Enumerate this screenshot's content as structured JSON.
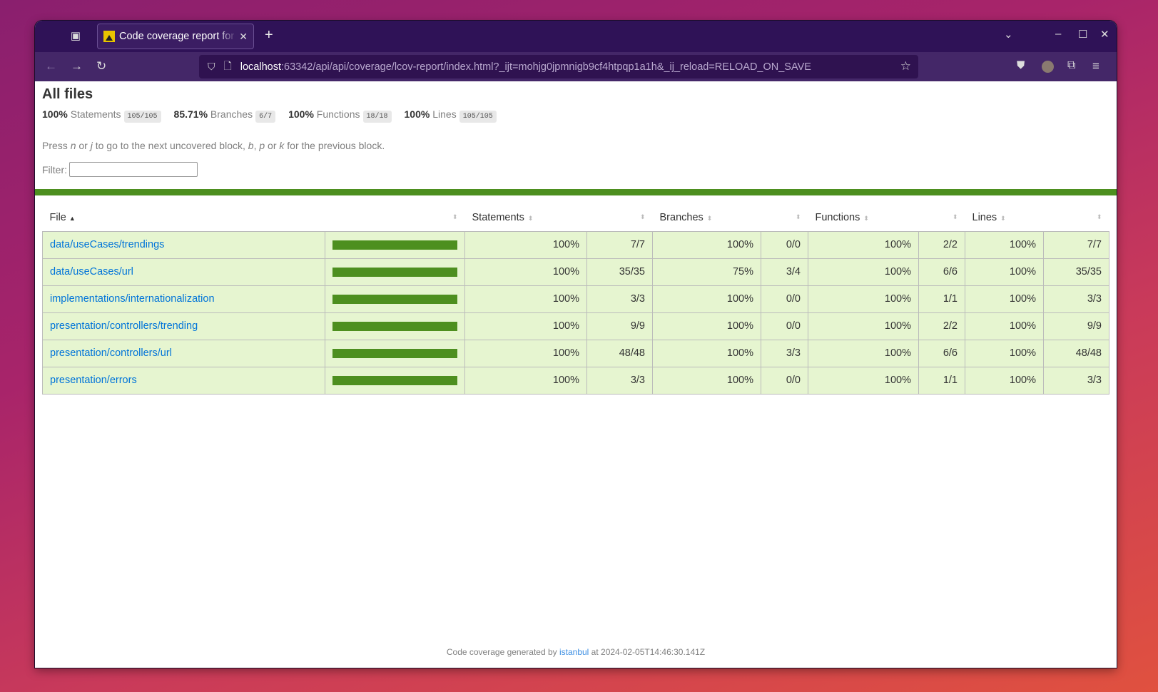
{
  "browser": {
    "tab_title": "Code coverage report for All files",
    "url_host": "localhost",
    "url_rest": ":63342/api/api/coverage/lcov-report/index.html?_ijt=mohjg0jpmnigb9cf4htpqp1a1h&_ij_reload=RELOAD_ON_SAVE"
  },
  "page": {
    "title": "All files",
    "summary": [
      {
        "pct": "100%",
        "label": "Statements",
        "fraction": "105/105"
      },
      {
        "pct": "85.71%",
        "label": "Branches",
        "fraction": "6/7"
      },
      {
        "pct": "100%",
        "label": "Functions",
        "fraction": "18/18"
      },
      {
        "pct": "100%",
        "label": "Lines",
        "fraction": "105/105"
      }
    ],
    "hint": {
      "p1": "Press ",
      "n": "n",
      "p2": " or ",
      "j": "j",
      "p3": " to go to the next uncovered block, ",
      "b": "b",
      "p4": ", ",
      "p": "p",
      "p5": " or ",
      "k": "k",
      "p6": " for the previous block."
    },
    "filter_label": "Filter:",
    "filter_value": "",
    "headers": {
      "file": "File",
      "statements": "Statements",
      "branches": "Branches",
      "functions": "Functions",
      "lines": "Lines"
    },
    "rows": [
      {
        "file": "data/useCases/trendings",
        "coverage": 100,
        "s_pct": "100%",
        "s": "7/7",
        "b_pct": "100%",
        "b": "0/0",
        "f_pct": "100%",
        "f": "2/2",
        "l_pct": "100%",
        "l": "7/7"
      },
      {
        "file": "data/useCases/url",
        "coverage": 100,
        "s_pct": "100%",
        "s": "35/35",
        "b_pct": "75%",
        "b": "3/4",
        "f_pct": "100%",
        "f": "6/6",
        "l_pct": "100%",
        "l": "35/35"
      },
      {
        "file": "implementations/internationalization",
        "coverage": 100,
        "s_pct": "100%",
        "s": "3/3",
        "b_pct": "100%",
        "b": "0/0",
        "f_pct": "100%",
        "f": "1/1",
        "l_pct": "100%",
        "l": "3/3"
      },
      {
        "file": "presentation/controllers/trending",
        "coverage": 100,
        "s_pct": "100%",
        "s": "9/9",
        "b_pct": "100%",
        "b": "0/0",
        "f_pct": "100%",
        "f": "2/2",
        "l_pct": "100%",
        "l": "9/9"
      },
      {
        "file": "presentation/controllers/url",
        "coverage": 100,
        "s_pct": "100%",
        "s": "48/48",
        "b_pct": "100%",
        "b": "3/3",
        "f_pct": "100%",
        "f": "6/6",
        "l_pct": "100%",
        "l": "48/48"
      },
      {
        "file": "presentation/errors",
        "coverage": 100,
        "s_pct": "100%",
        "s": "3/3",
        "b_pct": "100%",
        "b": "0/0",
        "f_pct": "100%",
        "f": "1/1",
        "l_pct": "100%",
        "l": "3/3"
      }
    ],
    "footer": {
      "prefix": "Code coverage generated by ",
      "link": "istanbul",
      "suffix": " at 2024-02-05T14:46:30.141Z"
    }
  },
  "colors": {
    "high_coverage_bg": "#e6f5d0",
    "bar_fill": "#4d8f1f",
    "link": "#0074d9",
    "browser_tabbar": "#2f1257"
  }
}
